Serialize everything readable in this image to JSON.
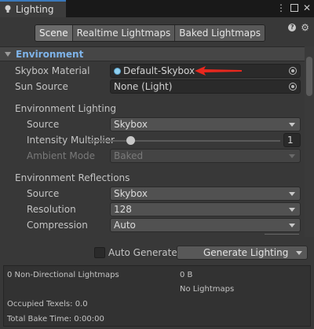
{
  "window": {
    "tab_title": "Lighting",
    "controls": {
      "menu": "⋮",
      "maximize": "□",
      "close": "✕"
    }
  },
  "toolbar": {
    "tabs": [
      {
        "label": "Scene",
        "active": true
      },
      {
        "label": "Realtime Lightmaps",
        "active": false
      },
      {
        "label": "Baked Lightmaps",
        "active": false
      }
    ],
    "help_icon": "?",
    "settings_icon": "⚙"
  },
  "environment": {
    "header": "Environment",
    "skybox_material": {
      "label": "Skybox Material",
      "value": "Default-Skybox"
    },
    "sun_source": {
      "label": "Sun Source",
      "value": "None (Light)"
    },
    "lighting": {
      "heading": "Environment Lighting",
      "source": {
        "label": "Source",
        "value": "Skybox"
      },
      "intensity": {
        "label": "Intensity Multiplier",
        "value": "1"
      },
      "ambient_mode": {
        "label": "Ambient Mode",
        "value": "Baked"
      }
    },
    "reflections": {
      "heading": "Environment Reflections",
      "source": {
        "label": "Source",
        "value": "Skybox"
      },
      "resolution": {
        "label": "Resolution",
        "value": "128"
      },
      "compression": {
        "label": "Compression",
        "value": "Auto"
      }
    }
  },
  "generate": {
    "auto_generate_label": "Auto Generate",
    "auto_generate_checked": false,
    "button_label": "Generate Lighting"
  },
  "stats": {
    "non_directional": "0 Non-Directional Lightmaps",
    "size": "0 B",
    "no_lightmaps": "No Lightmaps",
    "occupied_texels": "Occupied Texels: 0.0",
    "total_bake_time": "Total Bake Time: 0:00:00"
  },
  "colors": {
    "accent": "#3a79bb",
    "section_header_text": "#7fb4ea",
    "annotation_arrow": "#e8281e"
  }
}
